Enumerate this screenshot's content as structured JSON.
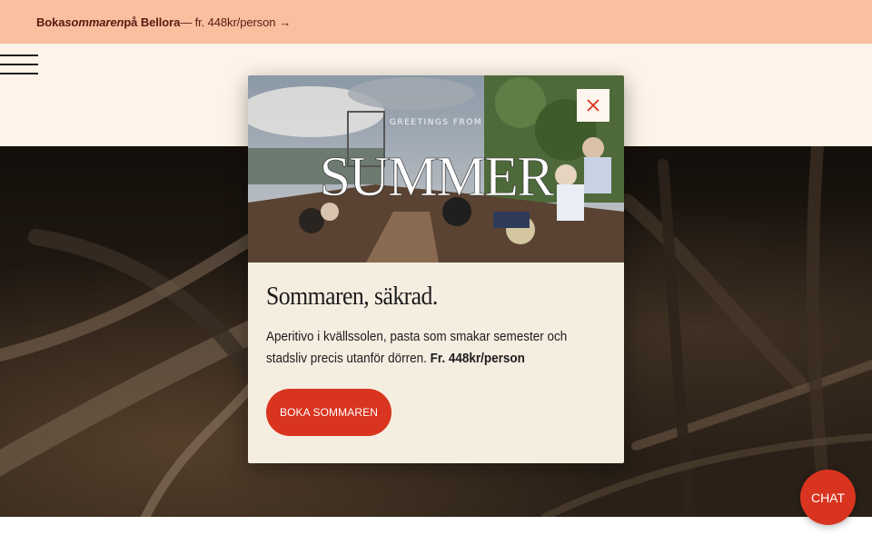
{
  "promo": {
    "part1": "Boka ",
    "part2": "sommaren",
    "part3": " på Bellora",
    "part4": " — fr. 448kr/person",
    "arrow": "→"
  },
  "modal": {
    "image_kicker": "GREETINGS FROM",
    "image_headline": "SUMMER",
    "title": "Sommaren, säkrad.",
    "text": "Aperitivo i kvällssolen, pasta som smakar semester och stadsliv precis utanför dörren.",
    "price": "Fr. 448kr/person",
    "cta_label": "BOKA SOMMAREN",
    "close_icon": "close-icon"
  },
  "chat": {
    "label": "CHAT"
  },
  "colors": {
    "promo_bg": "#f9bf9f",
    "header_bg": "#fdf3e8",
    "modal_bg": "#f6ede1",
    "accent": "#d9341f"
  }
}
